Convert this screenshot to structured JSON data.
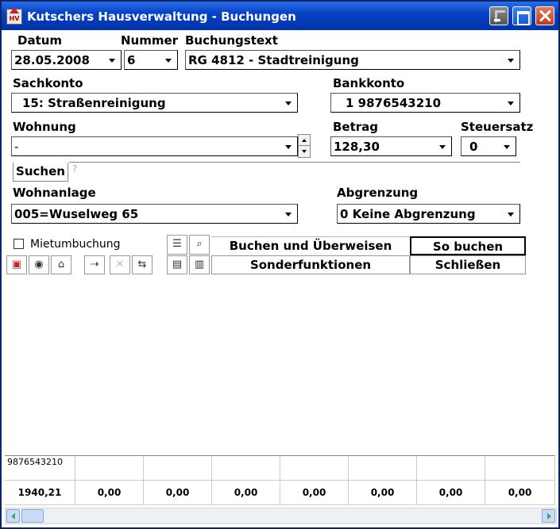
{
  "window": {
    "title": "Kutschers Hausverwaltung - Buchungen",
    "app_icon_text": "HV",
    "titlebar_color": "#0642c4"
  },
  "form": {
    "datum_label": "Datum",
    "datum_value": "28.05.2008",
    "nummer_label": "Nummer",
    "nummer_value": "6",
    "buchungstext_label": "Buchungstext",
    "buchungstext_value": "RG 4812 - Stadtreinigung",
    "sachkonto_label": "Sachkonto",
    "sachkonto_value": "15: Straßenreinigung",
    "bankkonto_label": "Bankkonto",
    "bankkonto_value": "1  9876543210",
    "wohnung_label": "Wohnung",
    "wohnung_value": "-",
    "betrag_label": "Betrag",
    "betrag_value": "128,30",
    "steuersatz_label": "Steuersatz",
    "steuersatz_value": "0",
    "suchen_label": "Suchen",
    "suchen_hint": "?",
    "wohnanlage_label": "Wohnanlage",
    "wohnanlage_value": "005=Wuselweg 65",
    "abgrenzung_label": "Abgrenzung",
    "abgrenzung_value": "0 Keine Abgrenzung"
  },
  "actions": {
    "mietumbuchung_label": "Mietumbuchung",
    "buchen_ueberweisen": "Buchen und Überweisen",
    "so_buchen": "So buchen",
    "sonderfunktionen": "Sonderfunktionen",
    "schliessen": "Schließen",
    "tools": [
      "new-document-icon",
      "piggy-bank-icon",
      "house-icon",
      "transfer-icon",
      "delete-icon",
      "swap-icon",
      "calculator-icon",
      "book-icon",
      "list-icon",
      "paperclip-icon"
    ]
  },
  "grid": {
    "account": "9876543210",
    "values": [
      "1940,21",
      "0,00",
      "0,00",
      "0,00",
      "0,00",
      "0,00",
      "0,00",
      "0,00"
    ]
  }
}
